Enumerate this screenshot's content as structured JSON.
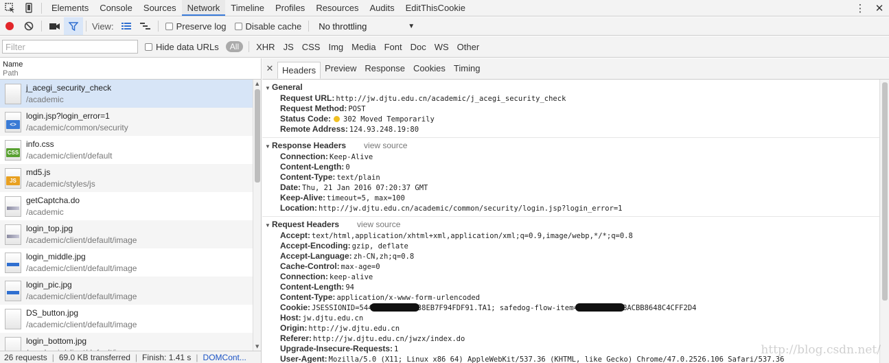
{
  "tabbar": {
    "tabs": [
      "Elements",
      "Console",
      "Sources",
      "Network",
      "Timeline",
      "Profiles",
      "Resources",
      "Audits",
      "EditThisCookie"
    ],
    "active": "Network"
  },
  "toolbar": {
    "view_label": "View:",
    "preserve_log": "Preserve log",
    "disable_cache": "Disable cache",
    "throttling": "No throttling"
  },
  "filterbar": {
    "placeholder": "Filter",
    "hide_data_urls": "Hide data URLs",
    "all": "All",
    "types": [
      "XHR",
      "JS",
      "CSS",
      "Img",
      "Media",
      "Font",
      "Doc",
      "WS",
      "Other"
    ]
  },
  "request_list": {
    "col_name": "Name",
    "col_path": "Path",
    "rows": [
      {
        "name": "j_acegi_security_check",
        "path": "/academic",
        "icon": "blank"
      },
      {
        "name": "login.jsp?login_error=1",
        "path": "/academic/common/security",
        "icon": "html"
      },
      {
        "name": "info.css",
        "path": "/academic/client/default",
        "icon": "css"
      },
      {
        "name": "md5.js",
        "path": "/academic/styles/js",
        "icon": "js"
      },
      {
        "name": "getCaptcha.do",
        "path": "/academic",
        "icon": "image"
      },
      {
        "name": "login_top.jpg",
        "path": "/academic/client/default/image",
        "icon": "image"
      },
      {
        "name": "login_middle.jpg",
        "path": "/academic/client/default/image",
        "icon": "image-blue"
      },
      {
        "name": "login_pic.jpg",
        "path": "/academic/client/default/image",
        "icon": "image-blue"
      },
      {
        "name": "DS_button.jpg",
        "path": "/academic/client/default/image",
        "icon": "blank"
      },
      {
        "name": "login_bottom.jpg",
        "path": "/academic/client/default/image",
        "icon": "blank"
      }
    ]
  },
  "status": {
    "requests": "26 requests",
    "transferred": "69.0 KB transferred",
    "finish": "Finish: 1.41 s",
    "domcontent": "DOMCont..."
  },
  "detail": {
    "tabs": [
      "Headers",
      "Preview",
      "Response",
      "Cookies",
      "Timing"
    ],
    "active": "Headers",
    "general": {
      "title": "General",
      "rows": [
        {
          "k": "Request URL:",
          "v": "http://jw.djtu.edu.cn/academic/j_acegi_security_check"
        },
        {
          "k": "Request Method:",
          "v": "POST"
        },
        {
          "k": "Status Code:",
          "v": "302 Moved Temporarily",
          "status_color": "#f0c022"
        },
        {
          "k": "Remote Address:",
          "v": "124.93.248.19:80"
        }
      ]
    },
    "response_headers": {
      "title": "Response Headers",
      "view_source": "view source",
      "rows": [
        {
          "k": "Connection:",
          "v": "Keep-Alive"
        },
        {
          "k": "Content-Length:",
          "v": "0"
        },
        {
          "k": "Content-Type:",
          "v": "text/plain"
        },
        {
          "k": "Date:",
          "v": "Thu, 21 Jan 2016 07:20:37 GMT"
        },
        {
          "k": "Keep-Alive:",
          "v": "timeout=5, max=100"
        },
        {
          "k": "Location:",
          "v": "http://jw.djtu.edu.cn/academic/common/security/login.jsp?login_error=1"
        }
      ]
    },
    "request_headers": {
      "title": "Request Headers",
      "view_source": "view source",
      "rows": [
        {
          "k": "Accept:",
          "v": "text/html,application/xhtml+xml,application/xml;q=0.9,image/webp,*/*;q=0.8"
        },
        {
          "k": "Accept-Encoding:",
          "v": "gzip, deflate"
        },
        {
          "k": "Accept-Language:",
          "v": "zh-CN,zh;q=0.8"
        },
        {
          "k": "Cache-Control:",
          "v": "max-age=0"
        },
        {
          "k": "Connection:",
          "v": "keep-alive"
        },
        {
          "k": "Content-Length:",
          "v": "94"
        },
        {
          "k": "Content-Type:",
          "v": "application/x-www-form-urlencoded"
        },
        {
          "k": "Host:",
          "v": "jw.djtu.edu.cn"
        },
        {
          "k": "Origin:",
          "v": "http://jw.djtu.edu.cn"
        },
        {
          "k": "Referer:",
          "v": "http://jw.djtu.edu.cn/jwzx/index.do"
        },
        {
          "k": "Upgrade-Insecure-Requests:",
          "v": "1"
        },
        {
          "k": "User-Agent:",
          "v": "Mozilla/5.0 (X11; Linux x86_64) AppleWebKit/537.36 (KHTML, like Gecko) Chrome/47.0.2526.106 Safari/537.36"
        }
      ],
      "cookie": {
        "k": "Cookie:",
        "v1": "JSESSIONID=544",
        "v2": "815C38EB7F94FDF91.TA1; safedog-flow-item=",
        "v3": "CCEEBACBB8648C4CFF2D4"
      }
    }
  },
  "watermark": "http://blog.csdn.net/"
}
